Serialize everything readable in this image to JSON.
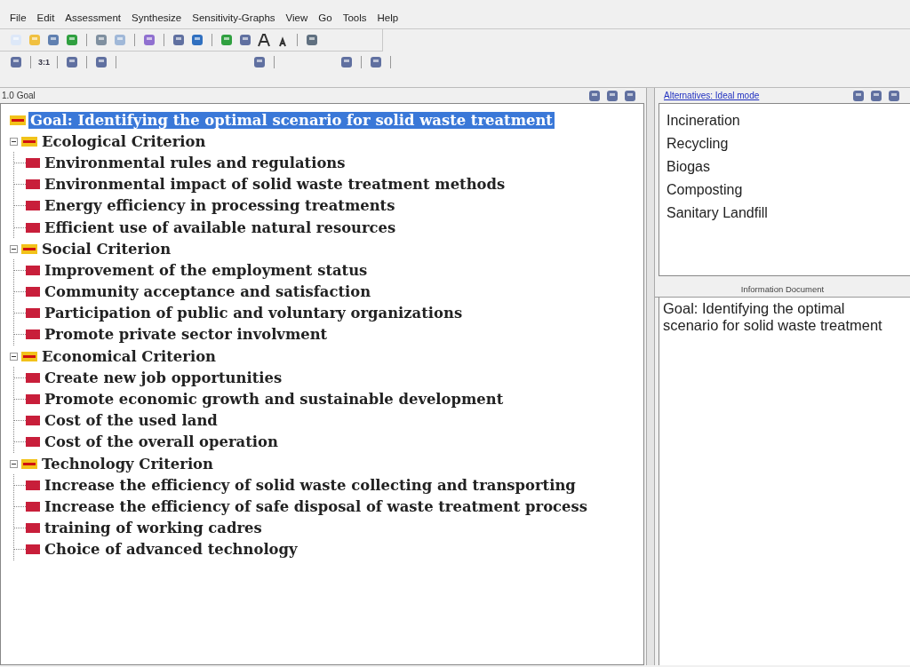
{
  "menu": [
    "File",
    "Edit",
    "Assessment",
    "Synthesize",
    "Sensitivity-Graphs",
    "View",
    "Go",
    "Tools",
    "Help"
  ],
  "toolbar2_labels": [
    "3:1"
  ],
  "tree_header": {
    "title": "1.0 Goal"
  },
  "alternatives_header": {
    "link": "Alternatives: Ideal mode"
  },
  "tree": [
    {
      "label": "Goal: Identifying the optimal scenario for solid waste treatment",
      "selected": true,
      "children": [
        {
          "label": "Ecological Criterion",
          "selected": false,
          "expanded": true,
          "children": [
            {
              "label": "Environmental rules and regulations",
              "selected": false
            },
            {
              "label": "Environmental impact of solid waste treatment methods",
              "selected": false
            },
            {
              "label": "Energy efficiency in processing treatments",
              "selected": false
            },
            {
              "label": "Efficient use of available natural resources",
              "selected": false
            }
          ]
        },
        {
          "label": "Social Criterion",
          "selected": false,
          "expanded": true,
          "children": [
            {
              "label": "Improvement of the employment status",
              "selected": false
            },
            {
              "label": "Community acceptance and satisfaction",
              "selected": false
            },
            {
              "label": "Participation of public and voluntary organizations",
              "selected": false
            },
            {
              "label": "Promote private sector involvment",
              "selected": false
            }
          ]
        },
        {
          "label": "Economical Criterion",
          "selected": false,
          "expanded": true,
          "children": [
            {
              "label": "Create new job opportunities",
              "selected": false
            },
            {
              "label": "Promote economic growth and sustainable development",
              "selected": false
            },
            {
              "label": "Cost of the used land",
              "selected": false
            },
            {
              "label": "Cost of the overall operation",
              "selected": false
            }
          ]
        },
        {
          "label": "Technology Criterion",
          "selected": false,
          "expanded": true,
          "children": [
            {
              "label": "Increase the efficiency of solid waste collecting and transporting",
              "selected": false
            },
            {
              "label": "Increase the efficiency of safe disposal of waste treatment process",
              "selected": false
            },
            {
              "label": "training of working cadres",
              "selected": false
            },
            {
              "label": "Choice of advanced technology",
              "selected": false
            }
          ]
        }
      ]
    }
  ],
  "alternatives": [
    "Incineration",
    "Recycling",
    "Biogas",
    "Composting",
    "Sanitary Landfill"
  ],
  "info_document": {
    "title": "Information Document",
    "text": "Goal: Identifying the optimal scenario for solid waste treatment"
  }
}
